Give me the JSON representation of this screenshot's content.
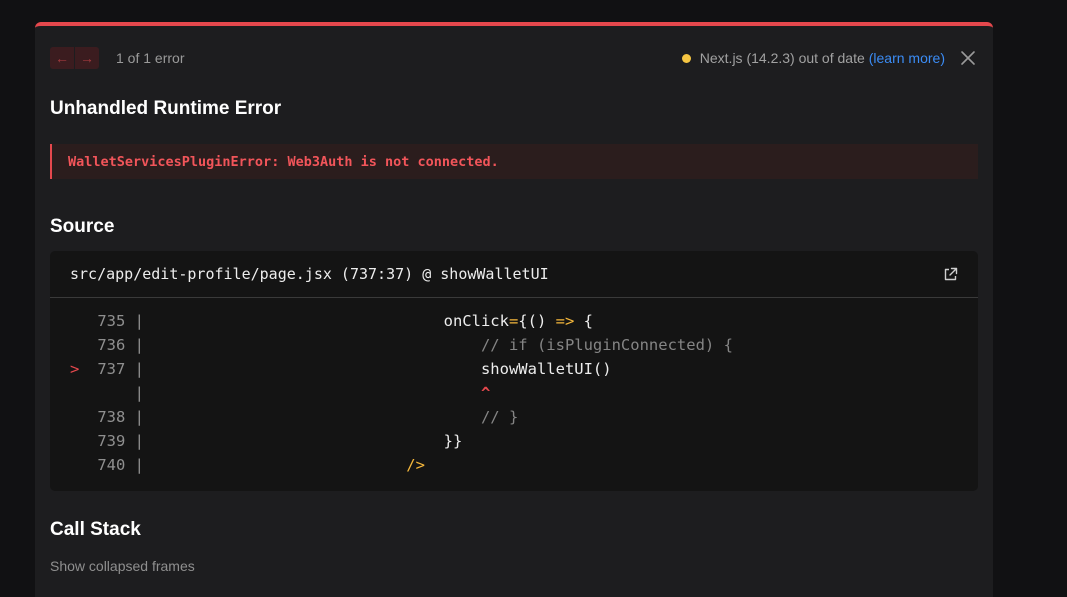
{
  "toolbar": {
    "prev_arrow": "←",
    "next_arrow": "→",
    "error_count": "1 of 1 error",
    "version_text": "Next.js (14.2.3) out of date",
    "learn_more": "(learn more)",
    "status_color": "#f5c542",
    "icons": [
      "arrow-left-icon",
      "arrow-right-icon",
      "close-icon"
    ]
  },
  "title": "Unhandled Runtime Error",
  "error_message": "WalletServicesPluginError: Web3Auth is not connected.",
  "source": {
    "heading": "Source",
    "file_location": "src/app/edit-profile/page.jsx (737:37) @ showWalletUI",
    "open_icon": "external-link-icon",
    "lines": [
      {
        "marker": "",
        "gutter": " 735 |",
        "indent": "                                ",
        "parts": [
          [
            "onClick",
            "plain"
          ],
          [
            "=",
            "op"
          ],
          [
            "{() ",
            "plain"
          ],
          [
            "=>",
            "op"
          ],
          [
            " {",
            "plain"
          ]
        ]
      },
      {
        "marker": "",
        "gutter": " 736 |",
        "indent": "                                    ",
        "parts": [
          [
            "// if (isPluginConnected) {",
            "comment"
          ]
        ]
      },
      {
        "marker": ">",
        "gutter": " 737 |",
        "indent": "                                    ",
        "parts": [
          [
            "showWalletUI()",
            "plain"
          ]
        ]
      },
      {
        "marker": "",
        "gutter": "     |",
        "indent": "                                    ",
        "parts": [
          [
            "^",
            "caret"
          ]
        ]
      },
      {
        "marker": "",
        "gutter": " 738 |",
        "indent": "                                    ",
        "parts": [
          [
            "// }",
            "comment"
          ]
        ]
      },
      {
        "marker": "",
        "gutter": " 739 |",
        "indent": "                                ",
        "parts": [
          [
            "}}",
            "plain"
          ]
        ]
      },
      {
        "marker": "",
        "gutter": " 740 |",
        "indent": "                            ",
        "parts": [
          [
            "/>",
            "op"
          ]
        ]
      }
    ]
  },
  "call_stack": {
    "heading": "Call Stack",
    "show_collapsed": "Show collapsed frames"
  },
  "colors": {
    "accent_red": "#e5484d",
    "warning_yellow": "#f5c542",
    "link_blue": "#3b8cf5"
  }
}
